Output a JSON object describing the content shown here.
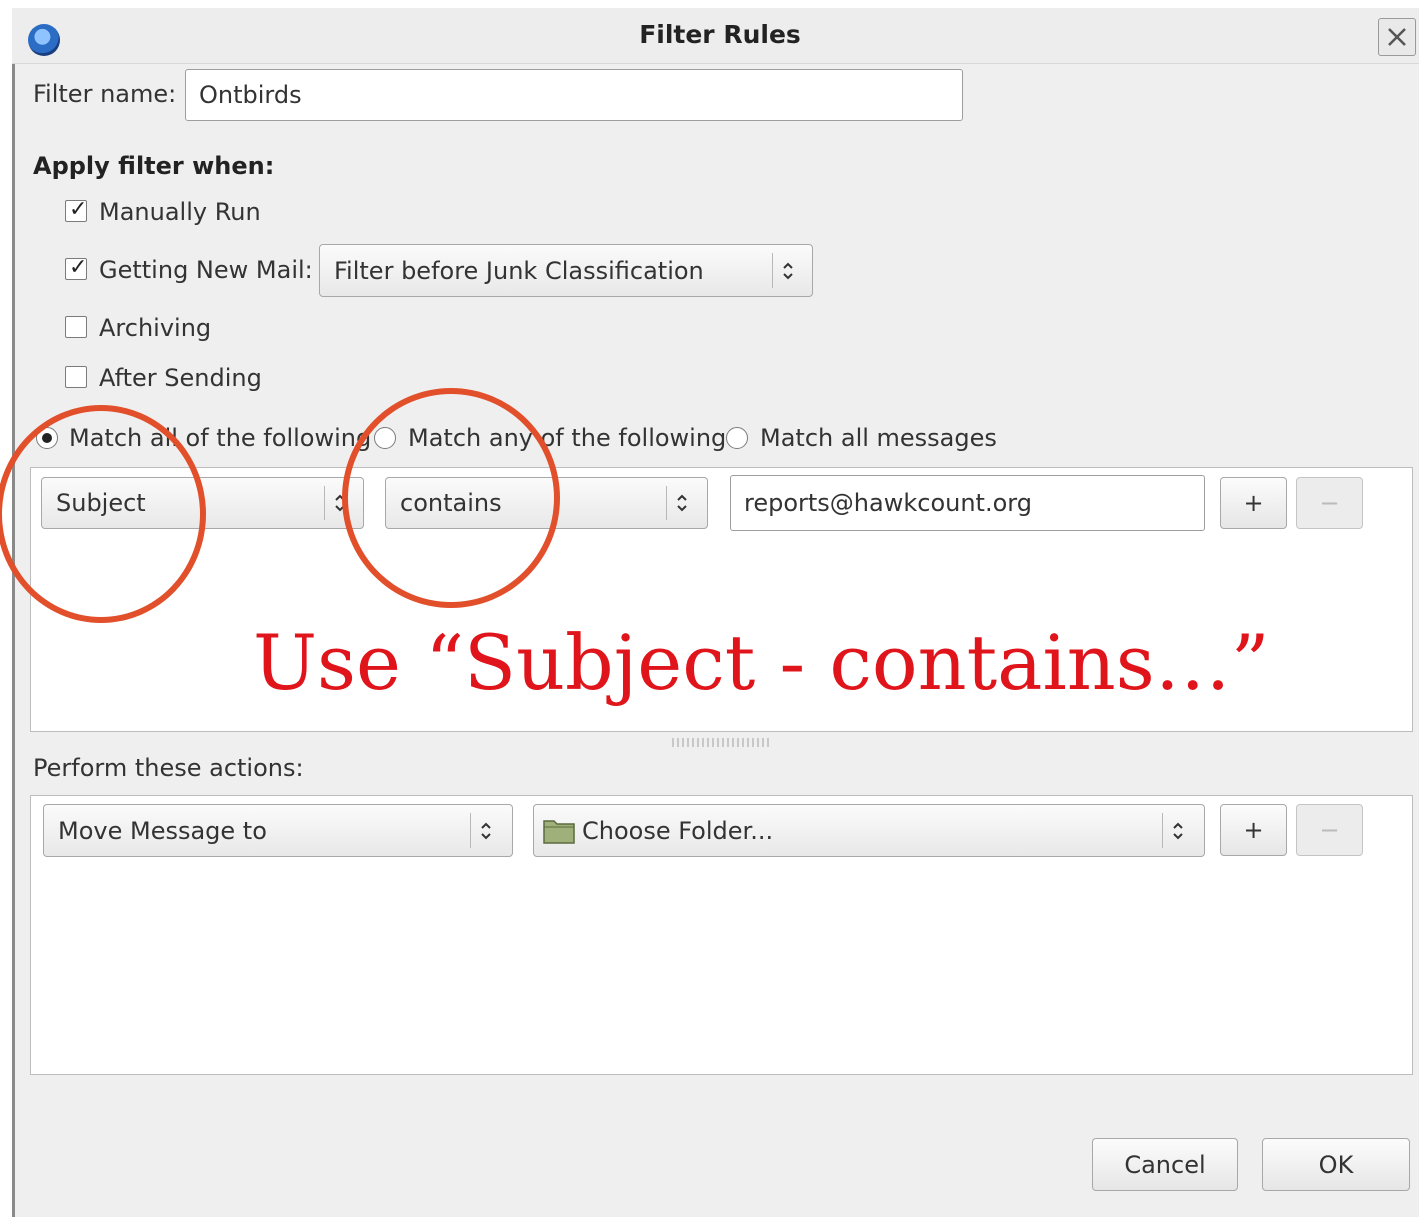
{
  "window": {
    "title": "Filter Rules",
    "app_icon": "thunderbird-icon",
    "close_icon": "close-icon"
  },
  "filter_name": {
    "label": "Filter name:",
    "value": "Ontbirds"
  },
  "apply_when": {
    "heading": "Apply filter when:",
    "manually_run": {
      "label": "Manually Run",
      "checked": true
    },
    "getting_new_mail": {
      "label": "Getting New Mail:",
      "checked": true,
      "timing_option": "Filter before Junk Classification"
    },
    "archiving": {
      "label": "Archiving",
      "checked": false
    },
    "after_sending": {
      "label": "After Sending",
      "checked": false
    }
  },
  "match_mode": {
    "all_label": "Match all of the following",
    "any_label": "Match any of the following",
    "all_messages_label": "Match all messages",
    "selected": "all"
  },
  "rule": {
    "field": "Subject",
    "operator": "contains",
    "value": "reports@hawkcount.org",
    "add_label": "+",
    "remove_label": "−"
  },
  "annotation": {
    "text": "Use “Subject - contains…”",
    "color": "#e0141b",
    "circle_color": "#e24f2b"
  },
  "actions": {
    "heading": "Perform these actions:",
    "action": "Move Message to",
    "folder": "Choose Folder...",
    "folder_icon": "folder-icon",
    "add_label": "+",
    "remove_label": "−"
  },
  "footer": {
    "cancel_label": "Cancel",
    "ok_label": "OK"
  }
}
